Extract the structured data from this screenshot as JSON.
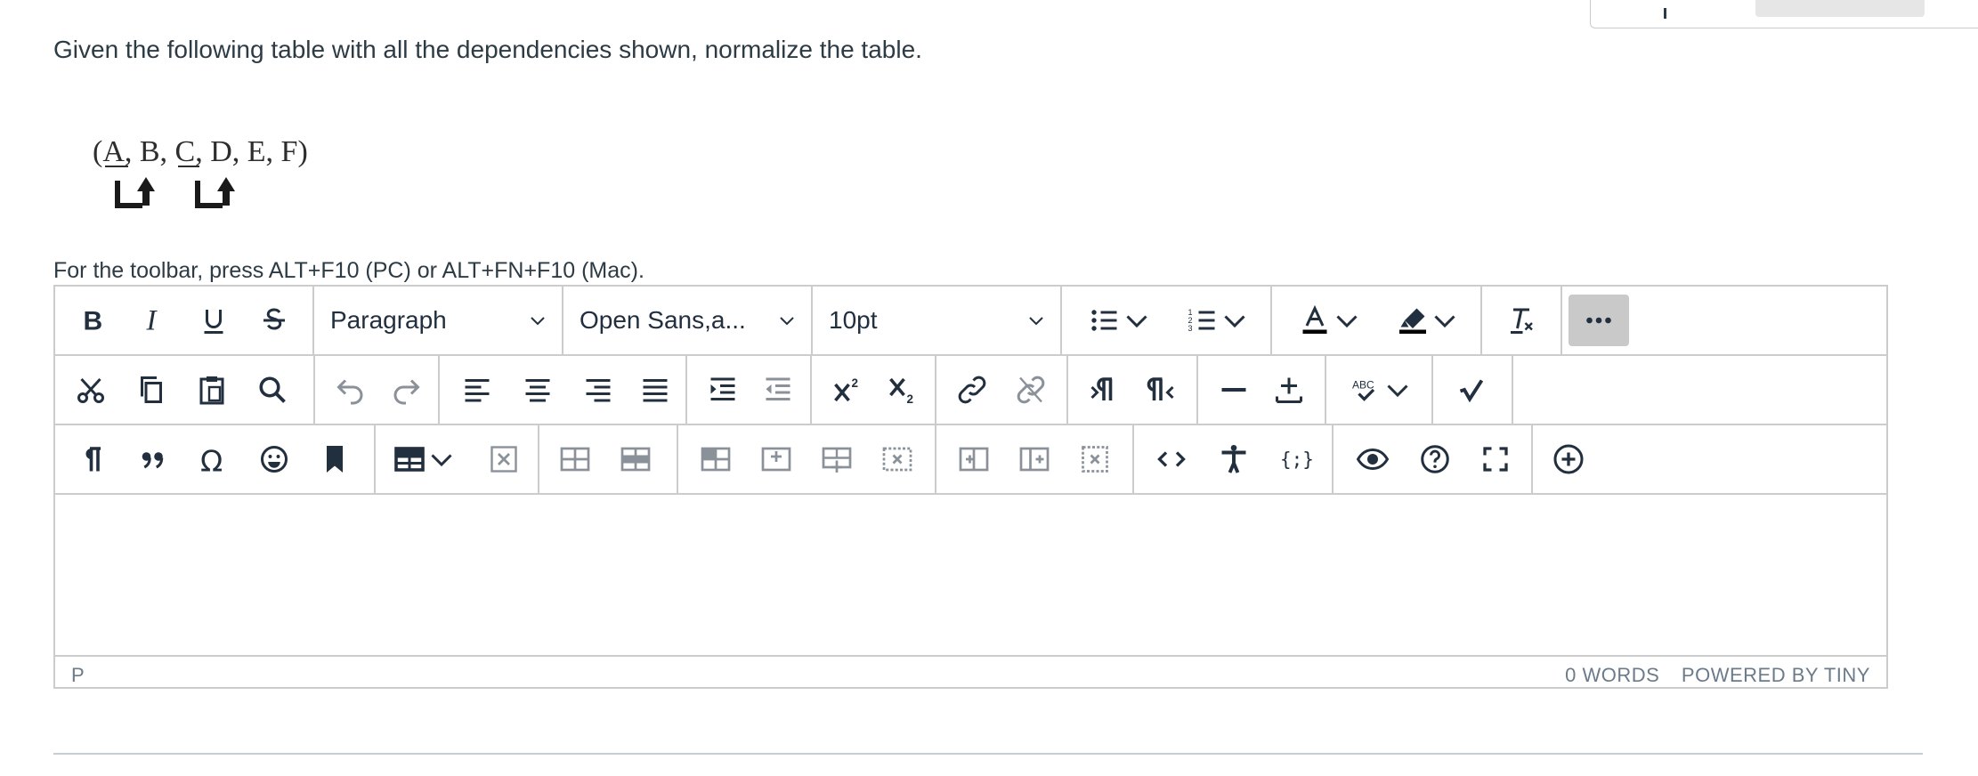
{
  "question": {
    "prompt": "Given the following table with all the dependencies shown, normalize the table.",
    "figure_text": "(A, B, C, D, E, F)"
  },
  "editor": {
    "hint": "For the toolbar, press ALT+F10 (PC) or ALT+FN+F10 (Mac).",
    "block_format": "Paragraph",
    "font_family": "Open Sans,a...",
    "font_size": "10pt",
    "status_path": "P",
    "word_count": "0 WORDS",
    "powered_by": "POWERED BY TINY"
  },
  "toolbar": {
    "row1": [
      "bold-icon",
      "italic-icon",
      "underline-icon",
      "strikethrough-icon",
      "bullet-list-icon",
      "numbered-list-icon",
      "text-color-icon",
      "highlight-icon",
      "clear-formatting-icon",
      "more-icon"
    ],
    "row2": [
      "cut-icon",
      "copy-icon",
      "paste-icon",
      "find-replace-icon",
      "undo-icon",
      "redo-icon",
      "align-left-icon",
      "align-center-icon",
      "align-right-icon",
      "justify-icon",
      "indent-icon",
      "outdent-icon",
      "superscript-icon",
      "subscript-icon",
      "link-icon",
      "unlink-icon",
      "ltr-icon",
      "rtl-icon",
      "horizontal-rule-icon",
      "plus-minus-icon",
      "spellcheck-icon",
      "equation-icon"
    ],
    "row3": [
      "paragraph-mark-icon",
      "blockquote-icon",
      "omega-icon",
      "emoji-icon",
      "bookmark-icon",
      "table-icon",
      "delete-table-icon",
      "table-props-icon",
      "row-props-icon",
      "cell-props-icon",
      "insert-row-before-icon",
      "insert-row-after-icon",
      "delete-row-icon",
      "insert-col-before-icon",
      "insert-col-after-icon",
      "delete-col-icon",
      "source-code-icon",
      "accessibility-icon",
      "template-icon",
      "preview-icon",
      "help-icon",
      "fullscreen-icon",
      "add-icon"
    ]
  },
  "colors": {
    "border": "#cccccc",
    "icon": "#222f3e",
    "active_bg": "#c9c9c9",
    "text": "#2d3b45"
  }
}
